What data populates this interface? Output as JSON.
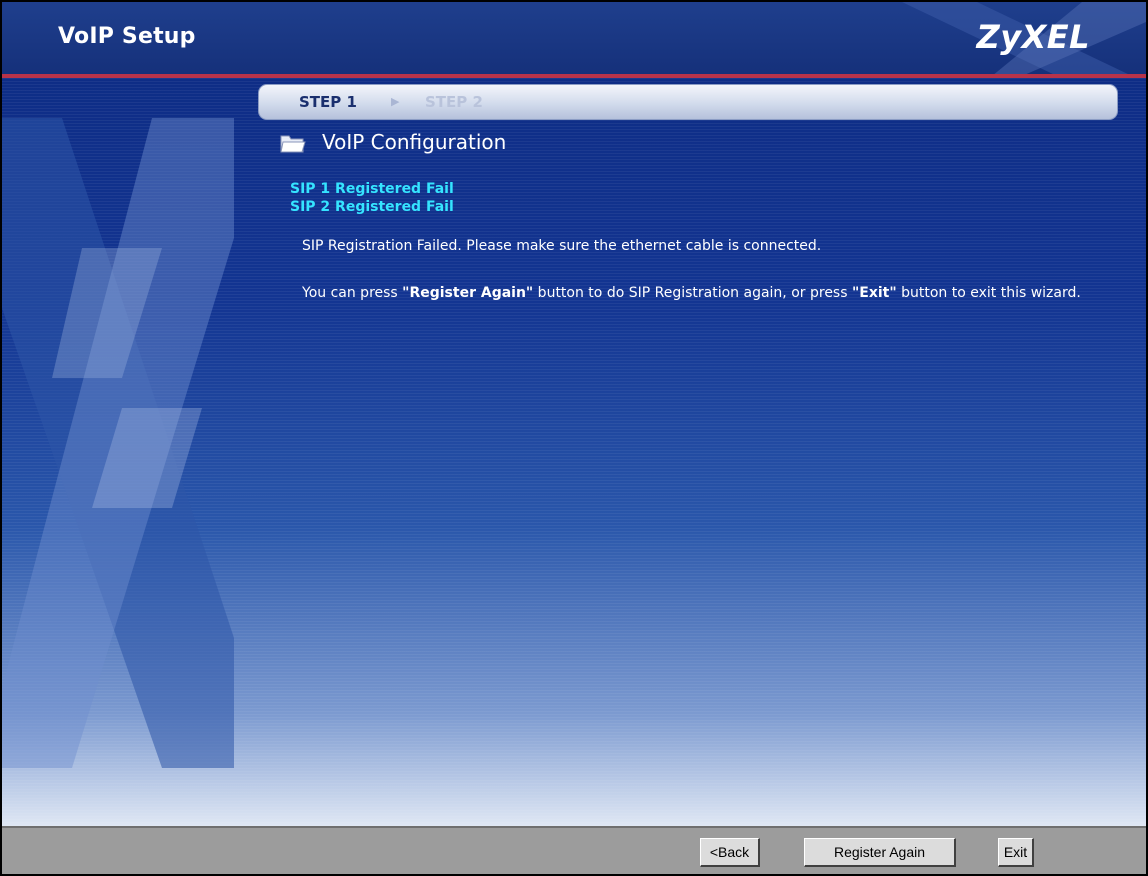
{
  "header": {
    "title": "VoIP Setup",
    "brand": "ZyXEL"
  },
  "steps": {
    "current": "STEP 1",
    "next": "STEP 2"
  },
  "section": {
    "title": "VoIP Configuration",
    "icon": "folder-icon"
  },
  "status": [
    "SIP 1 Registered Fail",
    "SIP 2 Registered Fail"
  ],
  "messages": {
    "failed": "SIP Registration Failed. Please make sure the ethernet cable is connected.",
    "hint_prefix": "You can press ",
    "hint_register": "\"Register Again\"",
    "hint_middle": " button to do SIP Registration again, or press ",
    "hint_exit": "\"Exit\"",
    "hint_suffix": " button to exit this wizard."
  },
  "buttons": {
    "back": "<Back",
    "register_again": "Register Again",
    "exit": "Exit"
  },
  "colors": {
    "header": "#1f3f8d",
    "accent_rule": "#b8334a",
    "status_text": "#35e4ff",
    "footer": "#9c9c9c"
  }
}
